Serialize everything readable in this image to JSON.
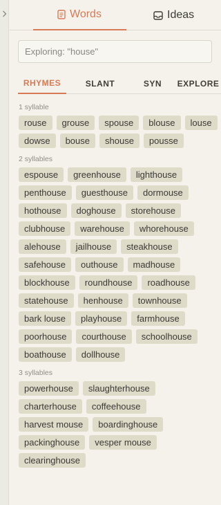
{
  "colors": {
    "accent": "#d97a57",
    "chip_bg": "#dedbc9",
    "background": "#f4f2ea"
  },
  "collapse_icon": "chevron-right-icon",
  "tabs": [
    {
      "label": "Words",
      "icon": "document-icon",
      "active": true
    },
    {
      "label": "Ideas",
      "icon": "inbox-icon",
      "active": false
    }
  ],
  "search": {
    "value": "Exploring: \"house\""
  },
  "sub_tabs": [
    {
      "label": "RHYMES",
      "active": true
    },
    {
      "label": "SLANT",
      "active": false
    },
    {
      "label": "SYN",
      "active": false
    },
    {
      "label": "EXPLORE",
      "active": false
    }
  ],
  "sections": [
    {
      "label": "1 syllable",
      "words": [
        "rouse",
        "grouse",
        "spouse",
        "blouse",
        "louse",
        "dowse",
        "bouse",
        "shouse",
        "pousse"
      ]
    },
    {
      "label": "2 syllables",
      "words": [
        "espouse",
        "greenhouse",
        "lighthouse",
        "penthouse",
        "guesthouse",
        "dormouse",
        "hothouse",
        "doghouse",
        "storehouse",
        "clubhouse",
        "warehouse",
        "whorehouse",
        "alehouse",
        "jailhouse",
        "steakhouse",
        "safehouse",
        "outhouse",
        "madhouse",
        "blockhouse",
        "roundhouse",
        "roadhouse",
        "statehouse",
        "henhouse",
        "townhouse",
        "bark louse",
        "playhouse",
        "farmhouse",
        "poorhouse",
        "courthouse",
        "schoolhouse",
        "boathouse",
        "dollhouse"
      ]
    },
    {
      "label": "3 syllables",
      "words": [
        "powerhouse",
        "slaughterhouse",
        "charterhouse",
        "coffeehouse",
        "harvest mouse",
        "boardinghouse",
        "packinghouse",
        "vesper mouse",
        "clearinghouse"
      ]
    }
  ]
}
